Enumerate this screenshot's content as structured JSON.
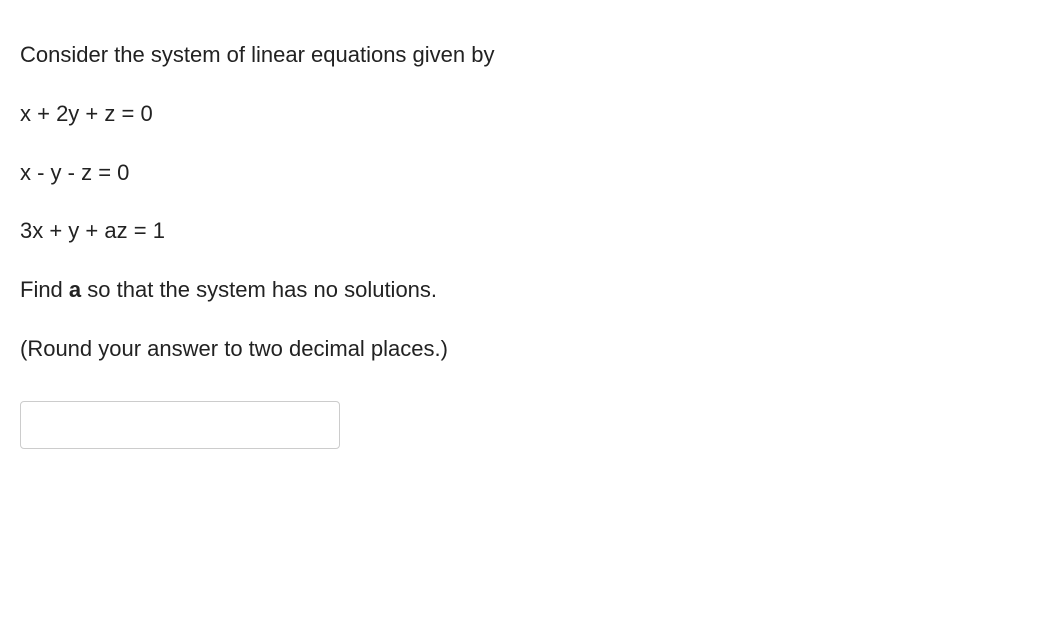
{
  "question": {
    "intro": "Consider the system of linear equations given by",
    "eq1": "x + 2y + z = 0",
    "eq2": "x - y - z = 0",
    "eq3": "3x + y + az = 1",
    "find_prefix": "Find ",
    "find_var": "a",
    "find_suffix": " so that the system has no solutions.",
    "round_note": "(Round your answer to two decimal places.)"
  },
  "input": {
    "value": "",
    "placeholder": ""
  }
}
